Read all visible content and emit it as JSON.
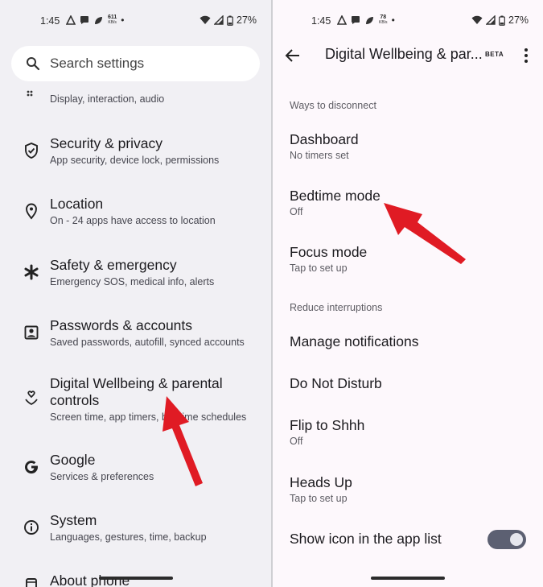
{
  "left": {
    "status": {
      "time": "1:45",
      "net_speed": "611",
      "net_unit": "KB/s",
      "dot": "•",
      "battery": "27%"
    },
    "search": {
      "placeholder": "Search settings"
    },
    "items": [
      {
        "title": "",
        "subtitle": "Display, interaction, audio",
        "icon": "accessibility-icon"
      },
      {
        "title": "Security & privacy",
        "subtitle": "App security, device lock, permissions",
        "icon": "shield-icon"
      },
      {
        "title": "Location",
        "subtitle": "On - 24 apps have access to location",
        "icon": "location-pin-icon"
      },
      {
        "title": "Safety & emergency",
        "subtitle": "Emergency SOS, medical info, alerts",
        "icon": "asterisk-icon"
      },
      {
        "title": "Passwords & accounts",
        "subtitle": "Saved passwords, autofill, synced accounts",
        "icon": "account-box-icon"
      },
      {
        "title": "Digital Wellbeing & parental controls",
        "title_line1": "Digital Wellbeing & parental",
        "title_line2": "controls",
        "subtitle": "Screen time, app timers, bedtime schedules",
        "subtitle_visible": "Screen time, app timers, b",
        "subtitle_tail": "time schedules",
        "icon": "wellbeing-icon"
      },
      {
        "title": "Google",
        "subtitle": "Services & preferences",
        "icon": "google-icon"
      },
      {
        "title": "System",
        "subtitle": "Languages, gestures, time, backup",
        "icon": "info-icon"
      },
      {
        "title": "About phone",
        "subtitle": "",
        "icon": "phone-icon"
      }
    ]
  },
  "right": {
    "status": {
      "time": "1:45",
      "net_speed": "78",
      "net_unit": "KB/s",
      "dot": "•",
      "battery": "27%"
    },
    "top_bar": {
      "title": "Digital Wellbeing & par...",
      "badge": "BETA"
    },
    "sections": [
      {
        "header": "Ways to disconnect",
        "items": [
          {
            "title": "Dashboard",
            "subtitle": "No timers set"
          },
          {
            "title": "Bedtime mode",
            "subtitle": "Off"
          },
          {
            "title": "Focus mode",
            "subtitle": "Tap to set up"
          }
        ]
      },
      {
        "header": "Reduce interruptions",
        "items": [
          {
            "title": "Manage notifications",
            "subtitle": ""
          },
          {
            "title": "Do Not Disturb",
            "subtitle": ""
          },
          {
            "title": "Flip to Shhh",
            "subtitle": "Off"
          },
          {
            "title": "Heads Up",
            "subtitle": "Tap to set up"
          },
          {
            "title": "Show icon in the app list",
            "subtitle": "",
            "toggle_on": true
          }
        ]
      }
    ]
  },
  "colors": {
    "arrow": "#e01b24",
    "left_bg": "#f1f0f4",
    "right_bg": "#fdf8fc",
    "toggle_track": "#5c6072"
  }
}
